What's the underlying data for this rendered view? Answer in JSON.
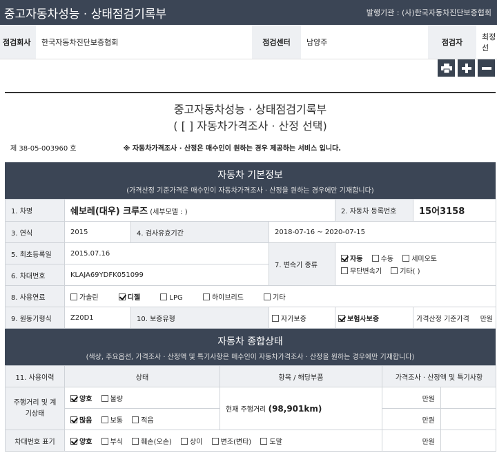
{
  "header": {
    "title": "중고자동차성능 · 상태점검기록부",
    "issuer": "발행기관 : (사)한국자동차진단보증협회"
  },
  "info": {
    "company_label": "점검회사",
    "company_value": "한국자동차진단보증협회",
    "center_label": "점검센터",
    "center_value": "남양주",
    "inspector_label": "점검자",
    "inspector_value": "최정선"
  },
  "toolbar": {
    "print": "print-icon",
    "expand": "plus-icon",
    "collapse": "minus-icon"
  },
  "document": {
    "title": "중고자동차성능 · 상태점검기록부",
    "subtitle": "( [ ] 자동차가격조사 · 산정 선택)",
    "number": "제 38-05-003960 호",
    "notice": "※ 자동차가격조사 · 산정은 매수인이 원하는 경우 제공하는 서비스 입니다."
  },
  "basic": {
    "heading": "자동차 기본정보",
    "note": "(가격산정 기준가격은 매수인이 자동차가격조사 · 산정을 원하는 경우에만 기재합니다)",
    "car_name_label": "1. 차명",
    "car_name_value": "쉐보레(대우) 크루즈",
    "car_name_sub": "(세부모델 : )",
    "reg_label": "2. 자동차 등록번호",
    "reg_value": "15어3158",
    "year_label": "3. 연식",
    "year_value": "2015",
    "validity_label": "4. 검사유효기간",
    "validity_value": "2018-07-16 ~ 2020-07-15",
    "first_reg_label": "5. 최초등록일",
    "first_reg_value": "2015.07.16",
    "trans_label": "7. 변속기 종류",
    "trans_options": [
      "자동",
      "수동",
      "세미오토",
      "무단변속기",
      "기타( )"
    ],
    "vin_label": "6. 차대번호",
    "vin_value": "KLAJA69YDFK051099",
    "fuel_label": "8. 사용연료",
    "fuel_options": [
      "가솔린",
      "디젤",
      "LPG",
      "하이브리드",
      "기타"
    ],
    "engine_label": "9. 원동기형식",
    "engine_value": "Z20D1",
    "warranty_label": "10. 보증유형",
    "warranty_options": [
      "자가보증",
      "보험사보증"
    ],
    "price_label": "가격산정 기준가격",
    "price_unit": "만원"
  },
  "overall": {
    "heading": "자동차 종합상태",
    "note": "(색상, 주요옵션, 가격조사 · 산정액 및 특기사항은 매수인이 자동차가격조사 · 산정을 원하는 경우에만 기재합니다)",
    "col_history": "11. 사용이력",
    "col_status": "상태",
    "col_item": "항목 / 해당부품",
    "col_price": "가격조사 · 산정액 및 특기사항",
    "row1_label": "주행거리 및 계기상태",
    "row1a_options": [
      "양호",
      "불량"
    ],
    "row1b_options": [
      "많음",
      "보통",
      "적음"
    ],
    "row1_item": "현재 주행거리",
    "row1_mileage": "(98,901km)",
    "row2_label": "차대번호 표기",
    "row2_options": [
      "양호",
      "부식",
      "훼손(오손)",
      "상이",
      "변조(변타)",
      "도말"
    ],
    "unit": "만원"
  }
}
